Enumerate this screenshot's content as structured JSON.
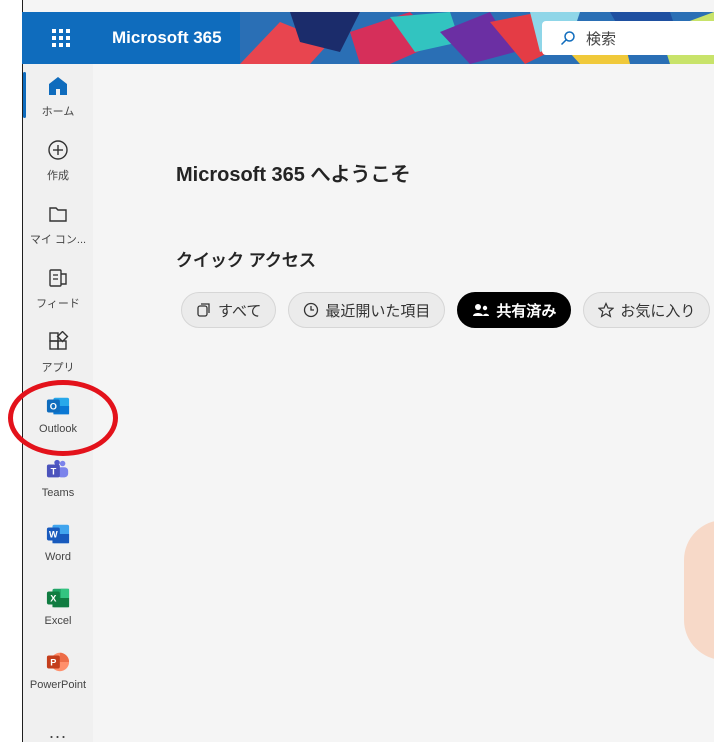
{
  "header": {
    "app_name": "Microsoft 365",
    "search_placeholder": "検索"
  },
  "rail": {
    "items": [
      {
        "label": "ホーム",
        "icon": "home-icon",
        "active": true
      },
      {
        "label": "作成",
        "icon": "create-icon"
      },
      {
        "label": "マイ コン...",
        "icon": "folder-icon"
      },
      {
        "label": "フィード",
        "icon": "feed-icon"
      },
      {
        "label": "アプリ",
        "icon": "apps-icon"
      },
      {
        "label": "Outlook",
        "icon": "outlook-icon"
      },
      {
        "label": "Teams",
        "icon": "teams-icon"
      },
      {
        "label": "Word",
        "icon": "word-icon"
      },
      {
        "label": "Excel",
        "icon": "excel-icon"
      },
      {
        "label": "PowerPoint",
        "icon": "powerpoint-icon"
      }
    ],
    "more": "..."
  },
  "main": {
    "welcome": "Microsoft 365 へようこそ",
    "quick_access": "クイック アクセス",
    "filters": [
      {
        "label": "すべて",
        "icon": "all-icon"
      },
      {
        "label": "最近開いた項目",
        "icon": "clock-icon"
      },
      {
        "label": "共有済み",
        "icon": "people-icon",
        "selected": true
      },
      {
        "label": "お気に入り",
        "icon": "star-icon"
      }
    ]
  },
  "colors": {
    "brand_blue": "#0f6cbd",
    "highlight_red": "#e3121b"
  }
}
